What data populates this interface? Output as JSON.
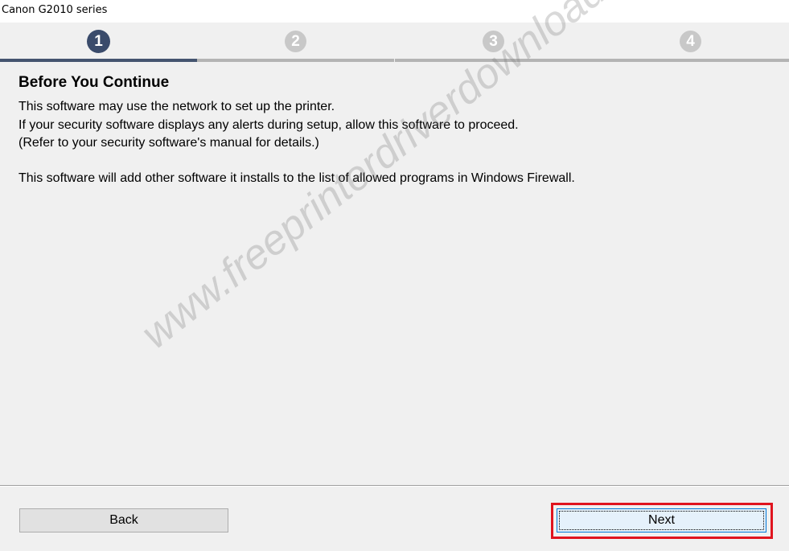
{
  "window": {
    "title": "Canon G2010 series"
  },
  "steps": [
    {
      "number": "1",
      "state": "active"
    },
    {
      "number": "2",
      "state": "inactive"
    },
    {
      "number": "3",
      "state": "inactive"
    },
    {
      "number": "4",
      "state": "inactive"
    }
  ],
  "content": {
    "heading": "Before You Continue",
    "paragraph1": [
      "This software may use the network to set up the printer.",
      "If your security software displays any alerts during setup, allow this software to proceed.",
      "(Refer to your security software's manual for details.)"
    ],
    "paragraph2": "This software will add other software it installs to the list of allowed programs in Windows Firewall."
  },
  "watermark": "www.freeprinterdriverdownload.org",
  "buttons": {
    "back_label": "Back",
    "next_label": "Next"
  },
  "colors": {
    "active_step": "#3a4b6b",
    "inactive_step": "#c8c8c8",
    "highlight": "#e0141e",
    "focus_border": "#0078d7"
  }
}
